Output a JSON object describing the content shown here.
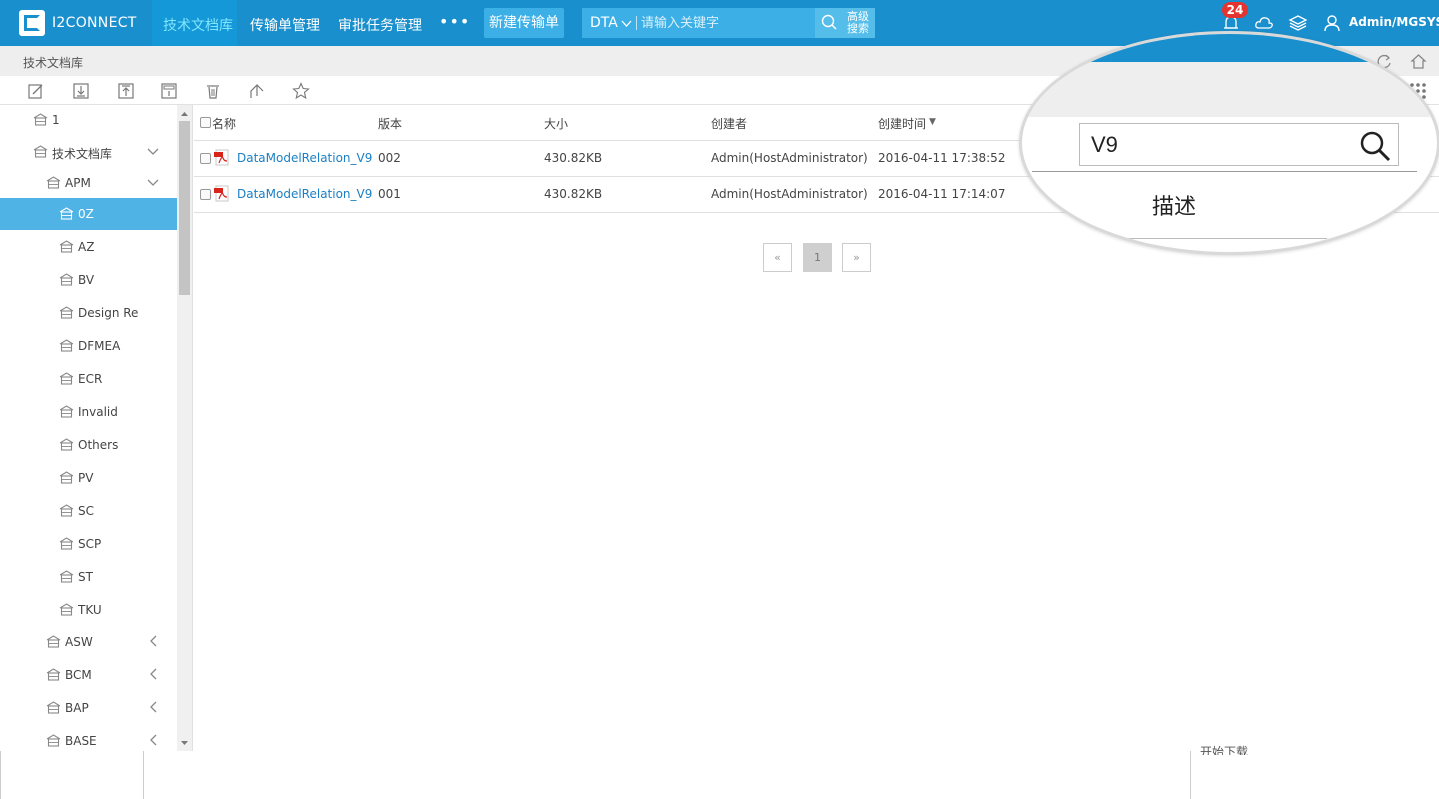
{
  "app": {
    "name": "I2CONNECT",
    "user": "Admin/MGSYS",
    "notification_count": "24"
  },
  "nav": {
    "items": [
      {
        "label": "技术文档库",
        "active": true
      },
      {
        "label": "传输单管理",
        "active": false
      },
      {
        "label": "审批任务管理",
        "active": false
      }
    ],
    "more": "•••",
    "new_button": "新建传输单"
  },
  "search": {
    "prefix": "DTA",
    "placeholder": "请输入关键字",
    "advanced_line1": "高级",
    "advanced_line2": "搜索"
  },
  "breadcrumb": "技术文档库",
  "tree": [
    {
      "label": "1",
      "level": 1
    },
    {
      "label": "技术文档库",
      "level": 1,
      "chevron": "down"
    },
    {
      "label": "APM",
      "level": 2,
      "chevron": "down"
    },
    {
      "label": "0Z",
      "level": 3,
      "selected": true
    },
    {
      "label": "AZ",
      "level": 3
    },
    {
      "label": "BV",
      "level": 3
    },
    {
      "label": "Design Re",
      "level": 3
    },
    {
      "label": "DFMEA",
      "level": 3
    },
    {
      "label": "ECR",
      "level": 3
    },
    {
      "label": "Invalid",
      "level": 3
    },
    {
      "label": "Others",
      "level": 3
    },
    {
      "label": "PV",
      "level": 3
    },
    {
      "label": "SC",
      "level": 3
    },
    {
      "label": "SCP",
      "level": 3
    },
    {
      "label": "ST",
      "level": 3
    },
    {
      "label": "TKU",
      "level": 3
    },
    {
      "label": "ASW",
      "level": 2,
      "chevron": "left"
    },
    {
      "label": "BCM",
      "level": 2,
      "chevron": "left"
    },
    {
      "label": "BAP",
      "level": 2,
      "chevron": "left"
    },
    {
      "label": "BASE",
      "level": 2,
      "chevron": "left"
    }
  ],
  "grid": {
    "columns": [
      "名称",
      "版本",
      "大小",
      "创建者",
      "创建时间"
    ],
    "sort_indicator": "▼",
    "rows": [
      {
        "name": "DataModelRelation_V9",
        "version": "002",
        "size": "430.82KB",
        "creator": "Admin(HostAdministrator)",
        "created": "2016-04-11 17:38:52"
      },
      {
        "name": "DataModelRelation_V9",
        "version": "001",
        "size": "430.82KB",
        "creator": "Admin(HostAdministrator)",
        "created": "2016-04-11 17:14:07"
      }
    ]
  },
  "pagination": {
    "prev": "«",
    "current": "1",
    "next": "»"
  },
  "magnifier": {
    "search_text": "V9",
    "description_label": "描述"
  },
  "bottom": {
    "partial_text": "开始下载"
  },
  "colors": {
    "header_blue": "#1a8fcd",
    "selected_row": "#4fb3e6",
    "link": "#1a7fc4",
    "badge_red": "#e3342f"
  }
}
